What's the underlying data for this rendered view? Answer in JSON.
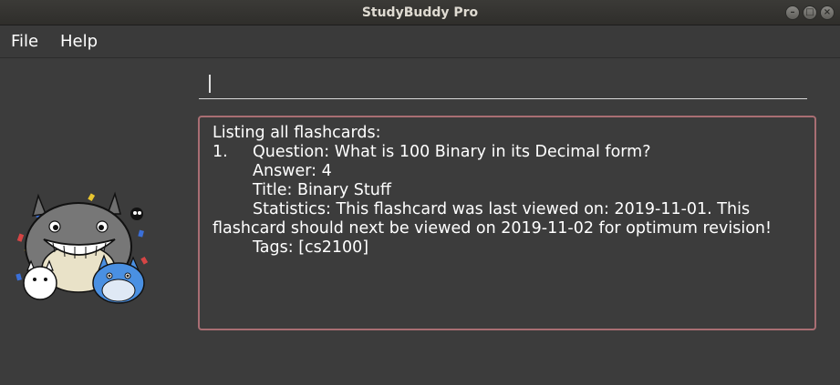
{
  "window": {
    "title": "StudyBuddy Pro"
  },
  "menu": {
    "items": [
      "File",
      "Help"
    ]
  },
  "command_box": {
    "value": ""
  },
  "result": {
    "header": "Listing all flashcards:",
    "cards": [
      {
        "number": "1.",
        "question": "Question: What is 100 Binary in its Decimal form?",
        "answer": "Answer: 4",
        "title": "Title: Binary Stuff",
        "statistics_line1": "Statistics: This flashcard was last viewed on: 2019-11-01. This",
        "statistics_line2": "flashcard should next be viewed on 2019-11-02 for optimum revision!",
        "tags": "Tags: [cs2100]"
      }
    ]
  }
}
